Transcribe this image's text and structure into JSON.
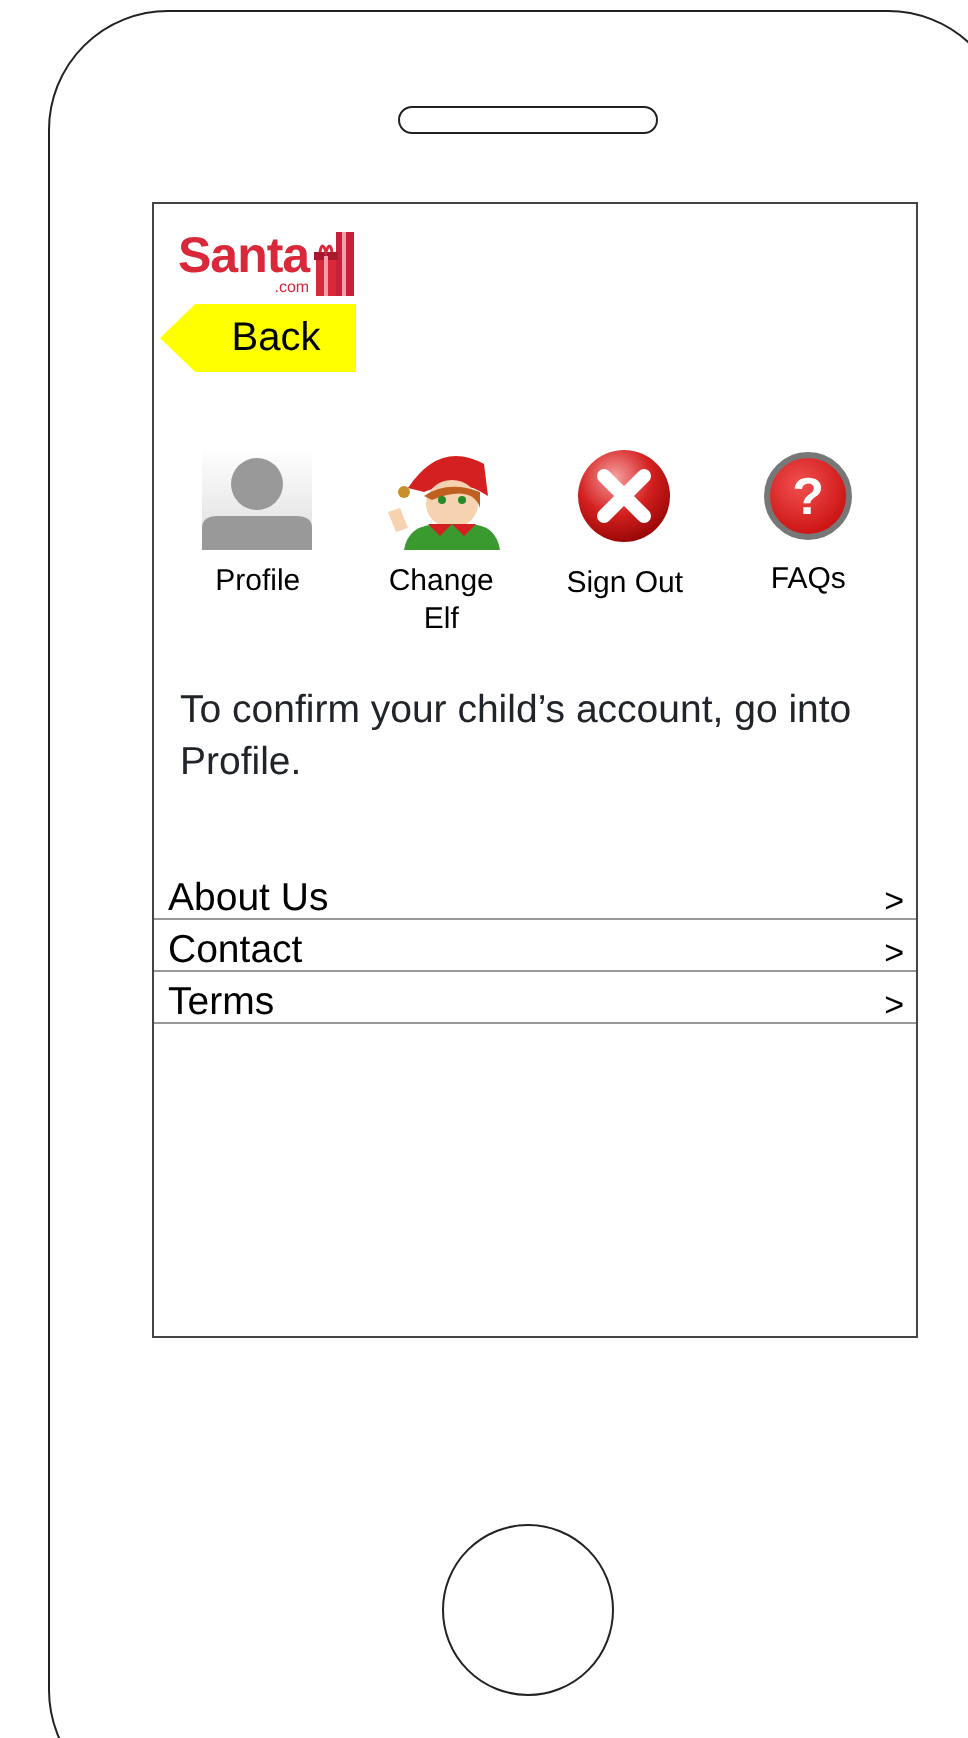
{
  "logo": {
    "text": "Santa",
    "suffix": ".com"
  },
  "back_button": {
    "label": "Back"
  },
  "shortcuts": [
    {
      "kind": "profile",
      "label": "Profile"
    },
    {
      "kind": "elf",
      "label": "Change Elf"
    },
    {
      "kind": "signout",
      "label": "Sign Out"
    },
    {
      "kind": "faq",
      "label": "FAQs",
      "glyph": "?"
    }
  ],
  "message": "To confirm your child’s account, go into Profile.",
  "menu": [
    {
      "label": "About Us",
      "chevron": ">"
    },
    {
      "label": "Contact",
      "chevron": ">"
    },
    {
      "label": "Terms",
      "chevron": ">"
    }
  ]
}
